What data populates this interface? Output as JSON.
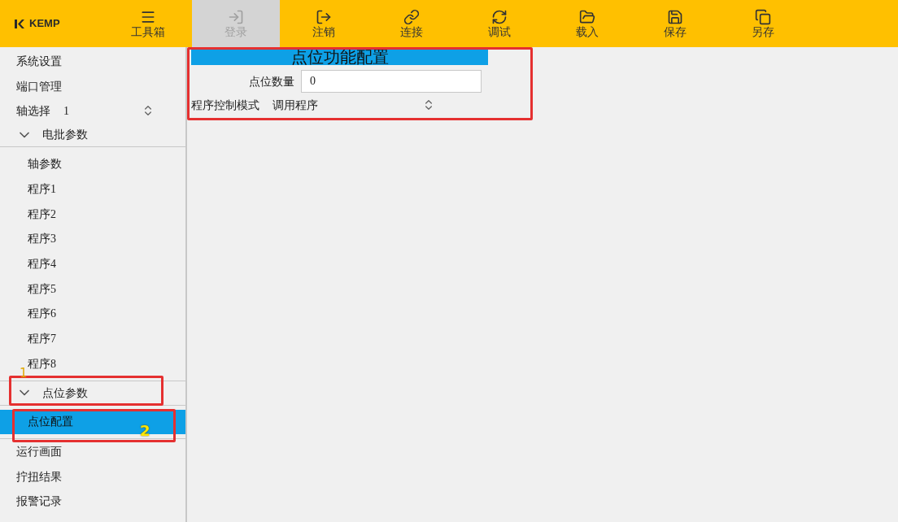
{
  "toolbar": {
    "logo": "KEMP",
    "items": [
      {
        "label": "工具箱",
        "disabled": false
      },
      {
        "label": "登录",
        "disabled": true
      },
      {
        "label": "注销",
        "disabled": false
      },
      {
        "label": "连接",
        "disabled": false
      },
      {
        "label": "调试",
        "disabled": false
      },
      {
        "label": "载入",
        "disabled": false
      },
      {
        "label": "保存",
        "disabled": false
      },
      {
        "label": "另存",
        "disabled": false
      }
    ]
  },
  "sidebar": {
    "items": [
      {
        "kind": "item",
        "label": "系统设置",
        "selected": false
      },
      {
        "kind": "item",
        "label": "端口管理",
        "selected": false
      },
      {
        "kind": "spinner",
        "label": "轴选择",
        "value": "1"
      },
      {
        "kind": "group",
        "label": "电批参数",
        "expanded": true,
        "children": [
          {
            "kind": "item",
            "label": "轴参数",
            "selected": false
          },
          {
            "kind": "item",
            "label": "程序1",
            "selected": false
          },
          {
            "kind": "item",
            "label": "程序2",
            "selected": false
          },
          {
            "kind": "item",
            "label": "程序3",
            "selected": false
          },
          {
            "kind": "item",
            "label": "程序4",
            "selected": false
          },
          {
            "kind": "item",
            "label": "程序5",
            "selected": false
          },
          {
            "kind": "item",
            "label": "程序6",
            "selected": false
          },
          {
            "kind": "item",
            "label": "程序7",
            "selected": false
          },
          {
            "kind": "item",
            "label": "程序8",
            "selected": false
          }
        ]
      },
      {
        "kind": "group",
        "label": "点位参数",
        "expanded": true,
        "children": [
          {
            "kind": "item",
            "label": "点位配置",
            "selected": true
          }
        ]
      },
      {
        "kind": "item",
        "label": "运行画面",
        "selected": false
      },
      {
        "kind": "item",
        "label": "拧扭结果",
        "selected": false
      },
      {
        "kind": "item",
        "label": "报警记录",
        "selected": false
      }
    ]
  },
  "panel": {
    "title": "点位功能配置",
    "fields": [
      {
        "kind": "input",
        "label": "点位数量",
        "value": "0"
      },
      {
        "kind": "select",
        "label": "程序控制模式",
        "value": "调用程序"
      }
    ]
  },
  "annotations": [
    "1",
    "2"
  ]
}
